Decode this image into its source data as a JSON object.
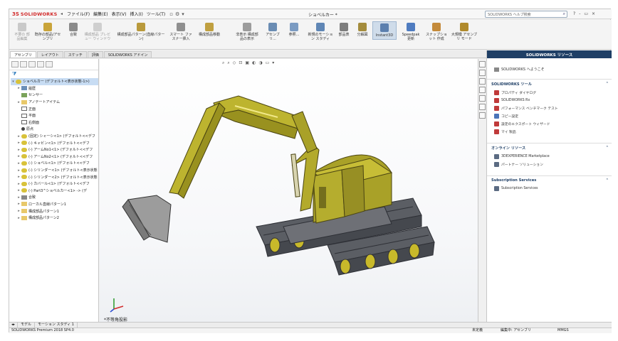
{
  "app": {
    "logo_mark": "3S",
    "logo_text": "SOLIDWORKS",
    "doc_title": "ショベルカー *",
    "menu": [
      "ファイル(F)",
      "編集(E)",
      "表示(V)",
      "挿入(I)",
      "ツール(T)"
    ],
    "help_search_placeholder": "SOLIDWORKS ヘルプ検索",
    "title_right": [
      "?",
      "-",
      "▭",
      "×"
    ]
  },
  "commands": [
    {
      "label": "不要の 部品編集",
      "dim": true
    },
    {
      "label": "既存の部品/アセンブリ",
      "dim": false
    },
    {
      "label": "合致",
      "dim": false
    },
    {
      "label": "構成部品 プレビュー ウィンドウ",
      "dim": true
    },
    {
      "label": "構成部品パターン(直線パターン)",
      "dim": false
    },
    {
      "label": "スマート ファスナー挿入",
      "dim": false
    },
    {
      "label": "構成部品移動",
      "dim": false
    },
    {
      "label": "非表示 構成部品の表示",
      "dim": false
    },
    {
      "label": "アセンブリ...",
      "dim": false
    },
    {
      "label": "参照...",
      "dim": false
    },
    {
      "label": "新規のモーション スタディ",
      "dim": false
    },
    {
      "label": "部品表",
      "dim": false
    },
    {
      "label": "分解図",
      "dim": false
    },
    {
      "label": "Instant3D",
      "dim": false
    },
    {
      "label": "Speedpak 更新",
      "dim": false
    },
    {
      "label": "スナップショット 作成",
      "dim": false
    },
    {
      "label": "大規模 アセンブリ モード",
      "dim": false
    }
  ],
  "tabs": [
    "アセンブリ",
    "レイアウト",
    "スケッチ",
    "評価",
    "SOLIDWORKS アドイン"
  ],
  "tree": {
    "root": "ショベルカー (デフォルト<表示状態-1>)",
    "items": [
      {
        "label": "履歴",
        "icon": "hist",
        "arrow": "▸"
      },
      {
        "label": "センサー",
        "icon": "sensor",
        "arrow": ""
      },
      {
        "label": "アノテートアイテム",
        "icon": "folder",
        "arrow": "▸"
      },
      {
        "label": "正面",
        "icon": "plane",
        "arrow": ""
      },
      {
        "label": "平面",
        "icon": "plane",
        "arrow": ""
      },
      {
        "label": "右側面",
        "icon": "plane",
        "arrow": ""
      },
      {
        "label": "原点",
        "icon": "origin",
        "arrow": ""
      },
      {
        "label": "(固定) シャーシ<1> (デフォルト<<デフ",
        "icon": "part",
        "arrow": "▸"
      },
      {
        "label": "(-) キャビン<1> (デフォルト<<デフ",
        "icon": "part",
        "arrow": "▸"
      },
      {
        "label": "(-) アームNo1<1> (デフォルト<<デフ",
        "icon": "part",
        "arrow": "▸"
      },
      {
        "label": "(-) アームNo2<1> (デフォルト<<デフ",
        "icon": "part",
        "arrow": "▸"
      },
      {
        "label": "(-) ショベル<1> (デフォルト<<デフ",
        "icon": "part",
        "arrow": "▸"
      },
      {
        "label": "(-) シリンダー<1> (デフォルト<表示状態",
        "icon": "part",
        "arrow": "▸"
      },
      {
        "label": "(-) シリンダー<2> (デフォルト<表示状態",
        "icon": "part",
        "arrow": "▸"
      },
      {
        "label": "(-) カバール<1> (デフォルト<<デフ",
        "icon": "part",
        "arrow": "▸"
      },
      {
        "label": "(-) Part3^ショベルカー<1> -> (デ",
        "icon": "part",
        "arrow": "▸"
      },
      {
        "label": "合致",
        "icon": "mate",
        "arrow": "▸"
      },
      {
        "label": "ローカル直線パターン1",
        "icon": "folder",
        "arrow": "▸"
      },
      {
        "label": "構成部品パターン1",
        "icon": "folder",
        "arrow": "▸"
      },
      {
        "label": "構成部品パターン2",
        "icon": "folder",
        "arrow": "▸"
      }
    ]
  },
  "viewport": {
    "hud_icons": [
      "⌕",
      "⌕",
      "◇",
      "⊡",
      "▣",
      "◐",
      "◑",
      "▭",
      "▾"
    ],
    "view_label": "*不等角投影"
  },
  "task_pane": {
    "title": "SOLIDWORKS リソース",
    "welcome": "SOLIDWORKS へようこそ",
    "sections": [
      {
        "title": "SOLIDWORKS ツール",
        "items": [
          "プロパティ ダイヤログ",
          "SOLIDWORKS Rx",
          "パフォーマンス ベンチマーク テスト",
          "コピー設定",
          "設定のエクスポート ウィザード",
          "マイ 製品"
        ]
      },
      {
        "title": "オンライン リソース",
        "items": [
          "3DEXPERIENCE Marketplace",
          "パートナー ソリューション"
        ]
      },
      {
        "title": "Subscription Services",
        "items": [
          "Subscription Services"
        ]
      }
    ]
  },
  "bottom_tabs": [
    "モデル",
    "モーション スタディ 1"
  ],
  "status": {
    "left": "SOLIDWORKS Premium 2018 SP4.0",
    "state": "未定義",
    "edit": "編集中: アセンブリ",
    "units": "MMGS"
  }
}
